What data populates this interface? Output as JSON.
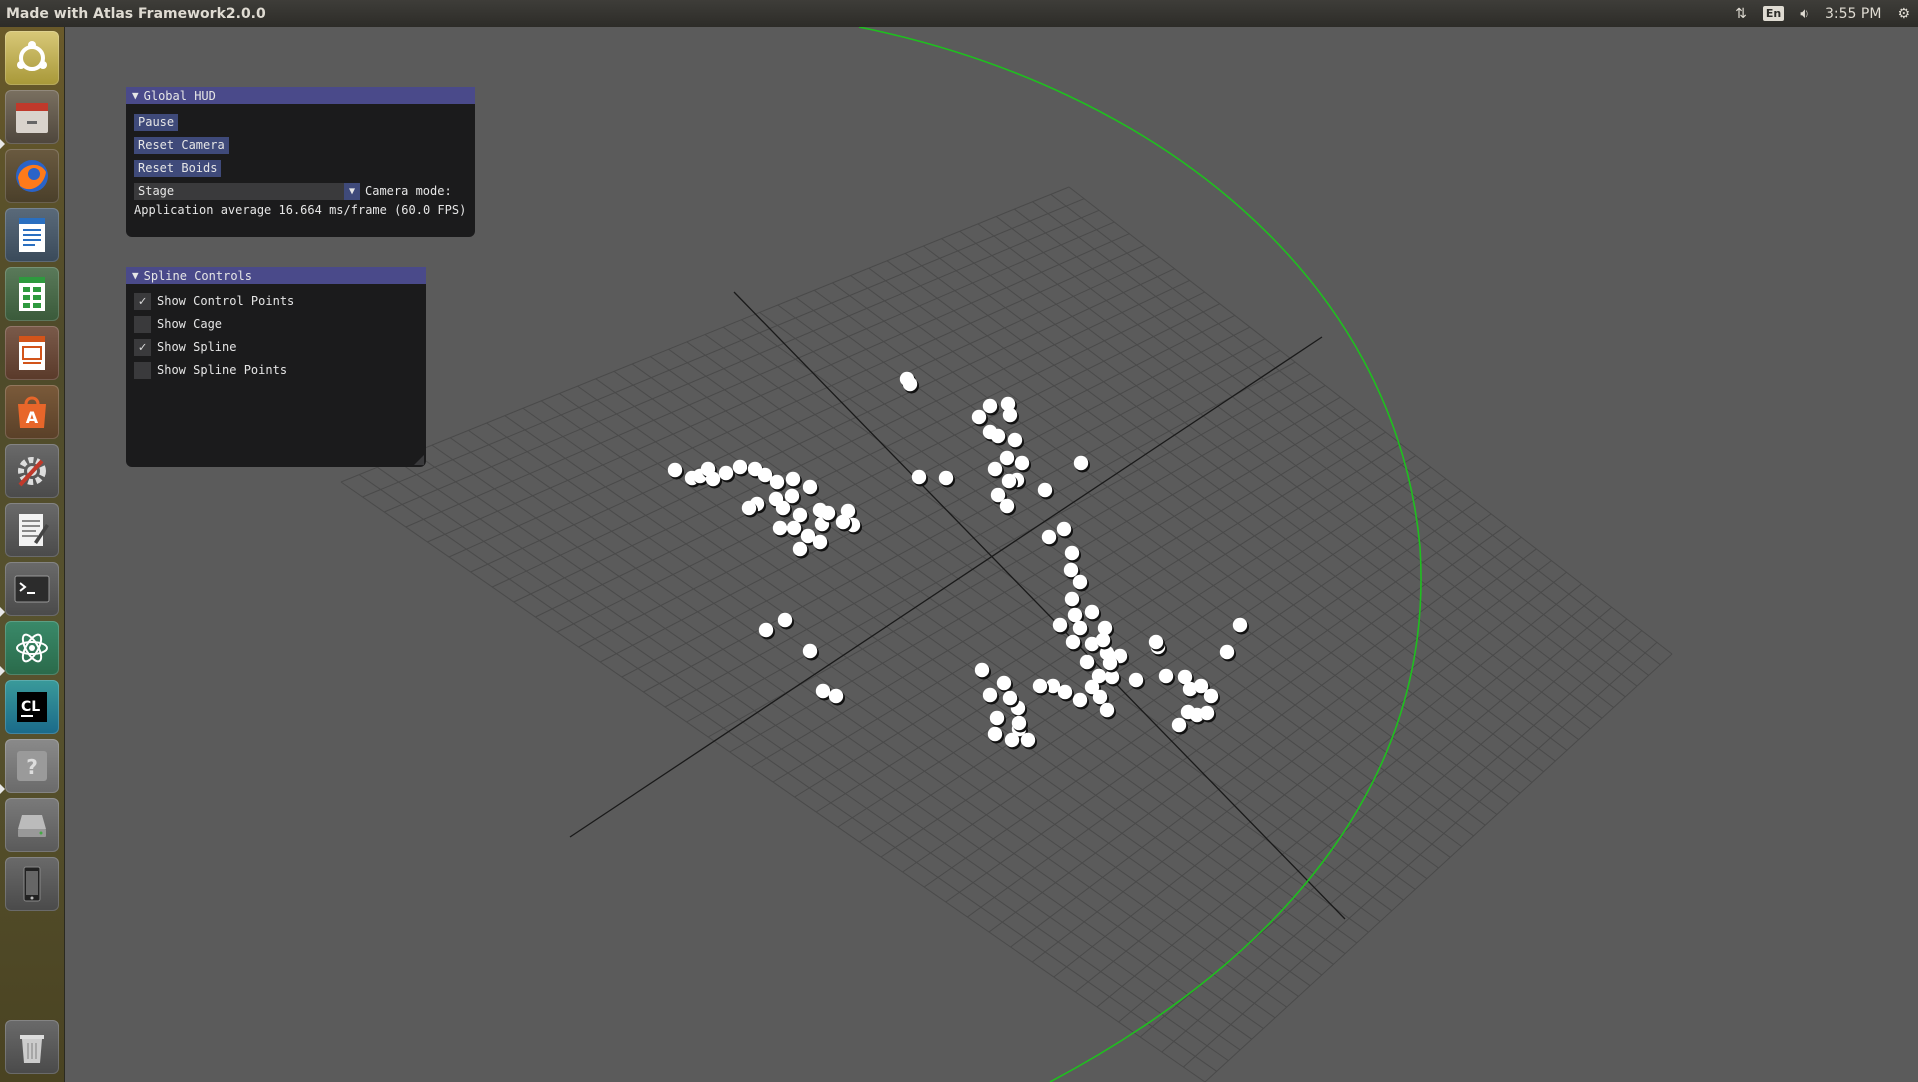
{
  "topbar": {
    "title": "Made with Atlas Framework2.0.0",
    "language": "En",
    "time": "3:55 PM"
  },
  "launcher": {
    "items": [
      {
        "name": "ubuntu-dash-icon"
      },
      {
        "name": "files-icon"
      },
      {
        "name": "firefox-icon"
      },
      {
        "name": "writer-icon"
      },
      {
        "name": "calc-icon"
      },
      {
        "name": "impress-icon"
      },
      {
        "name": "software-center-icon"
      },
      {
        "name": "system-settings-icon"
      },
      {
        "name": "text-editor-icon"
      },
      {
        "name": "terminal-icon"
      },
      {
        "name": "atom-icon"
      },
      {
        "name": "clion-icon"
      },
      {
        "name": "help-icon"
      },
      {
        "name": "drive-icon"
      },
      {
        "name": "phone-icon"
      },
      {
        "name": "trash-icon"
      }
    ]
  },
  "global_hud": {
    "title": "Global HUD",
    "pause_label": "Pause",
    "reset_camera_label": "Reset Camera",
    "reset_boids_label": "Reset Boids",
    "camera_mode_value": "Stage",
    "camera_mode_label": "Camera mode:",
    "fps_text": "Application average 16.664 ms/frame (60.0 FPS)"
  },
  "spline_controls": {
    "title": "Spline Controls",
    "options": [
      {
        "label": "Show Control Points",
        "checked": true
      },
      {
        "label": "Show Cage",
        "checked": false
      },
      {
        "label": "Show Spline",
        "checked": true
      },
      {
        "label": "Show Spline Points",
        "checked": false
      }
    ]
  },
  "scene": {
    "spline_color": "#1fbf1f",
    "boid_color": "#ffffff",
    "background_color": "#5b5b5b",
    "grid_color": "#4a4a4a",
    "axis_color": "#1a1a1a"
  }
}
